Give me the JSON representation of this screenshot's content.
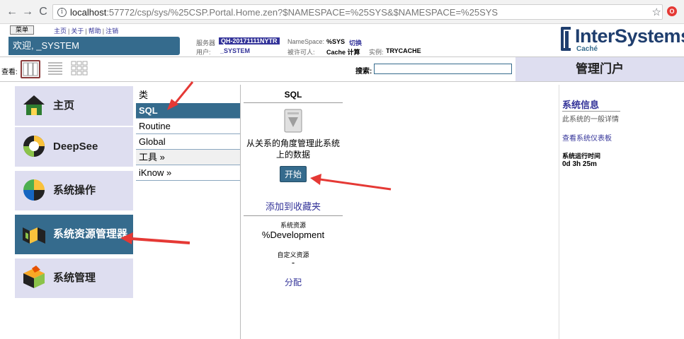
{
  "browser": {
    "url_host": "localhost",
    "url_path": ":57772/csp/sys/%25CSP.Portal.Home.zen?$NAMESPACE=%25SYS&$NAMESPACE=%25SYS"
  },
  "header": {
    "menu_label": "菜单",
    "links": [
      "主页",
      "关于",
      "帮助",
      "注销"
    ],
    "welcome": "欢迎, _SYSTEM",
    "server_label": "服务器",
    "server_value": "QH-20171111NYTR",
    "namespace_label": "NameSpace:",
    "namespace_value": "%SYS",
    "switch_label": "切换",
    "user_label": "用户:",
    "user_value": "_SYSTEM",
    "licensee_label": "被许可人:",
    "licensee_value": "Cache 计算",
    "instance_label": "实例:",
    "instance_value": "TRYCACHE",
    "logo_text": "InterSystems",
    "logo_sub": "Caché"
  },
  "toolbar": {
    "view_label": "查看:",
    "search_label": "搜索:",
    "search_value": "",
    "portal_title": "管理门户"
  },
  "nav": [
    {
      "label": "主页",
      "icon": "home-icon"
    },
    {
      "label": "DeepSee",
      "icon": "deepsee-icon"
    },
    {
      "label": "系统操作",
      "icon": "system-operation-icon"
    },
    {
      "label": "系统资源管理器",
      "icon": "system-explorer-icon"
    },
    {
      "label": "系统管理",
      "icon": "system-admin-icon"
    }
  ],
  "categories": {
    "header": "类",
    "items": [
      "SQL",
      "Routine",
      "Global",
      "工具 »",
      "iKnow »"
    ]
  },
  "detail": {
    "title": "SQL",
    "description": "从关系的角度管理此系统上的数据",
    "start_label": "开始",
    "favorite_label": "添加到收藏夹",
    "resource_caption": "系统资源",
    "resource_value": "%Development",
    "custom_caption": "自定义资源",
    "custom_value": "-",
    "assign_label": "分配"
  },
  "sysinfo": {
    "title": "系统信息",
    "subtitle": "此系统的一般详情",
    "dashboard_link": "查看系统仪表板",
    "uptime_label": "系统运行时间",
    "uptime_value": "0d 3h 25m"
  },
  "colors": {
    "accent": "#356b8d",
    "nav_bg": "#dedef0",
    "link": "#333399",
    "arrow": "#e53935"
  }
}
